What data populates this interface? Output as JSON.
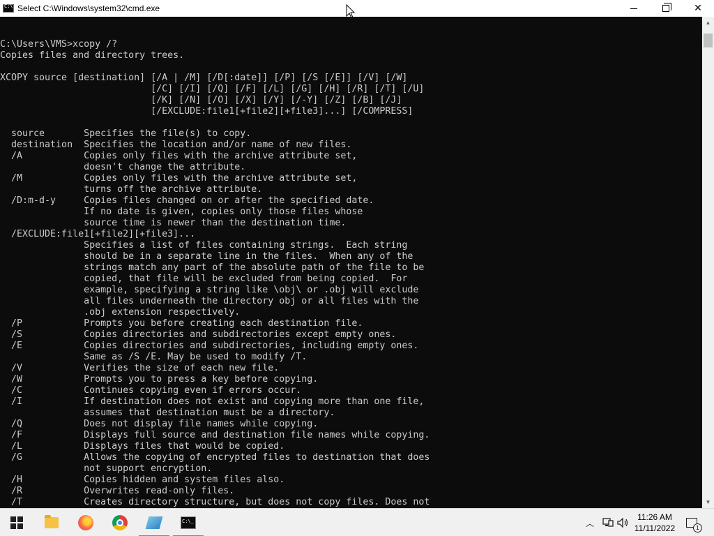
{
  "window": {
    "title": "Select C:\\Windows\\system32\\cmd.exe",
    "minimize_label": "",
    "maximize_label": "",
    "close_label": "✕"
  },
  "console": {
    "lines": [
      "C:\\Users\\VMS>xcopy /?",
      "Copies files and directory trees.",
      "",
      "XCOPY source [destination] [/A | /M] [/D[:date]] [/P] [/S [/E]] [/V] [/W]",
      "                           [/C] [/I] [/Q] [/F] [/L] [/G] [/H] [/R] [/T] [/U]",
      "                           [/K] [/N] [/O] [/X] [/Y] [/-Y] [/Z] [/B] [/J]",
      "                           [/EXCLUDE:file1[+file2][+file3]...] [/COMPRESS]",
      "",
      "  source       Specifies the file(s) to copy.",
      "  destination  Specifies the location and/or name of new files.",
      "  /A           Copies only files with the archive attribute set,",
      "               doesn't change the attribute.",
      "  /M           Copies only files with the archive attribute set,",
      "               turns off the archive attribute.",
      "  /D:m-d-y     Copies files changed on or after the specified date.",
      "               If no date is given, copies only those files whose",
      "               source time is newer than the destination time.",
      "  /EXCLUDE:file1[+file2][+file3]...",
      "               Specifies a list of files containing strings.  Each string",
      "               should be in a separate line in the files.  When any of the",
      "               strings match any part of the absolute path of the file to be",
      "               copied, that file will be excluded from being copied.  For",
      "               example, specifying a string like \\obj\\ or .obj will exclude",
      "               all files underneath the directory obj or all files with the",
      "               .obj extension respectively.",
      "  /P           Prompts you before creating each destination file.",
      "  /S           Copies directories and subdirectories except empty ones.",
      "  /E           Copies directories and subdirectories, including empty ones.",
      "               Same as /S /E. May be used to modify /T.",
      "  /V           Verifies the size of each new file.",
      "  /W           Prompts you to press a key before copying.",
      "  /C           Continues copying even if errors occur.",
      "  /I           If destination does not exist and copying more than one file,",
      "               assumes that destination must be a directory.",
      "  /Q           Does not display file names while copying.",
      "  /F           Displays full source and destination file names while copying.",
      "  /L           Displays files that would be copied.",
      "  /G           Allows the copying of encrypted files to destination that does",
      "               not support encryption.",
      "  /H           Copies hidden and system files also.",
      "  /R           Overwrites read-only files.",
      "  /T           Creates directory structure, but does not copy files. Does not"
    ]
  },
  "taskbar": {
    "time": "11:26 AM",
    "date": "11/11/2022",
    "notification_count": "1",
    "icons": [
      "windows-start-icon",
      "file-explorer-icon",
      "firefox-icon",
      "chrome-icon",
      "notepad-icon",
      "cmd-icon"
    ]
  },
  "colors": {
    "console_bg": "#0c0c0c",
    "console_fg": "#cccccc",
    "taskbar_bg": "#f0f0f0",
    "active_indicator": "#4a8fd8"
  }
}
